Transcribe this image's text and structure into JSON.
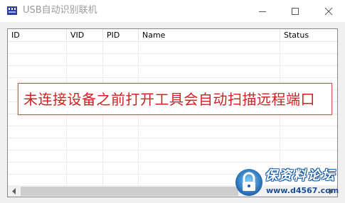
{
  "window": {
    "title": "USB自动识别联机"
  },
  "listview": {
    "columns": [
      {
        "label": "ID"
      },
      {
        "label": "VID"
      },
      {
        "label": "PID"
      },
      {
        "label": "Name"
      },
      {
        "label": "Status"
      }
    ]
  },
  "annotation": {
    "text": "未连接设备之前打开工具会自动扫描远程端口",
    "color": "#d21f1f"
  },
  "watermark": {
    "title": "保资料论坛",
    "url": "www.d4567.com"
  },
  "colors": {
    "accent": "#1c5fa8"
  }
}
